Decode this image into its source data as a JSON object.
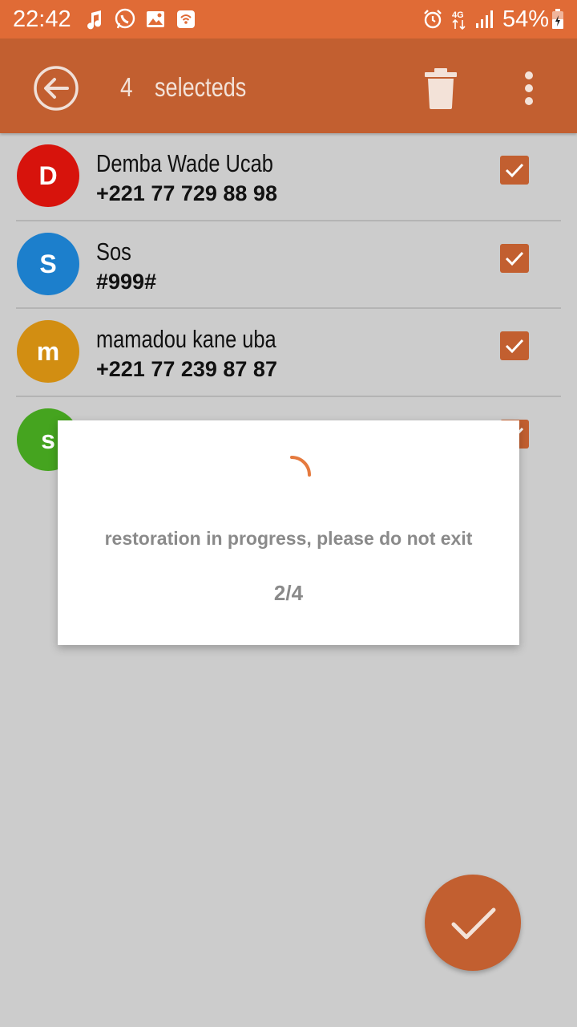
{
  "status": {
    "time": "22:42",
    "battery": "54%",
    "network": "4G",
    "icons": [
      "music-icon",
      "whatsapp-icon",
      "gallery-icon",
      "wifi-calling-icon",
      "alarm-icon",
      "network-4g-icon",
      "signal-icon",
      "battery-charging-icon"
    ]
  },
  "appbar": {
    "count": "4",
    "label": "selecteds"
  },
  "contacts": [
    {
      "initial": "D",
      "name": "Demba Wade Ucab",
      "phone": "+221 77 729 88 98",
      "color": "#d7130c"
    },
    {
      "initial": "S",
      "name": "Sos",
      "phone": "#999#",
      "color": "#1c7fcc"
    },
    {
      "initial": "m",
      "name": "mamadou kane uba",
      "phone": "+221 77 239 87 87",
      "color": "#d28e12"
    },
    {
      "initial": "s",
      "name": "",
      "phone": "",
      "color": "#45a41f"
    }
  ],
  "dialog": {
    "message": "restoration in progress, please do not exit",
    "progress": "2/4"
  },
  "colors": {
    "statusbar": "#e06b36",
    "appbar": "#c25f30",
    "accent": "#c25f30",
    "spinner": "#e57a3e"
  }
}
